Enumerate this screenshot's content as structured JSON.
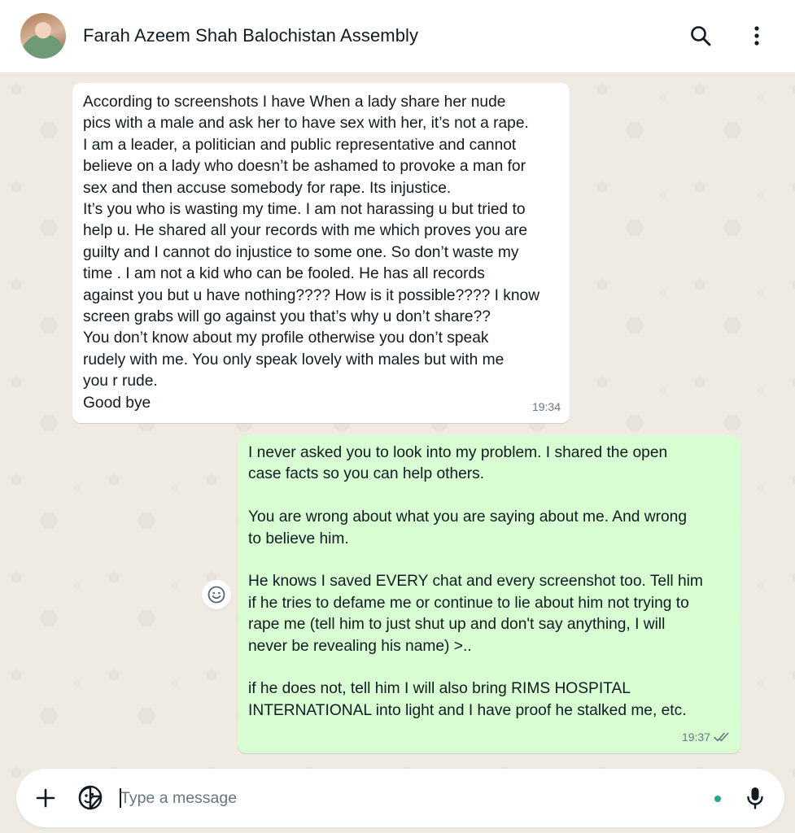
{
  "header": {
    "contact_name": "Farah Azeem Shah Balochistan Assembly",
    "icons": [
      "search-icon",
      "more-menu-icon"
    ]
  },
  "messages": [
    {
      "direction": "incoming",
      "time": "19:34",
      "lines": [
        "According to screenshots I have When a lady share her nude",
        "pics with a male and ask her to have sex with her, it’s not a rape.",
        "I am a leader, a politician and public representative and cannot",
        "believe on a lady who doesn’t be ashamed to provoke a man for",
        "sex and then accuse somebody for rape. Its injustice.",
        "It’s you who is wasting my time. I am not harassing u but tried to",
        "help u. He shared all your records with me which proves you are",
        "guilty and I cannot do injustice to some one. So don’t waste my",
        "time . I am not a kid who can be fooled. He has all records",
        "against you but u have nothing???? How is it possible???? I know",
        "screen grabs will go against you that’s why u don’t share??",
        "You don’t know about my profile otherwise you don’t speak",
        "rudely with me. You only speak lovely with males but with me",
        "you r rude.",
        "Good bye"
      ]
    },
    {
      "direction": "outgoing",
      "time": "19:37",
      "status": "read",
      "lines": [
        "I never asked you to look into my problem. I shared the open",
        "case facts so you can help others.",
        "",
        "You are wrong about what you are saying about me. And wrong",
        "to believe him.",
        "",
        "He knows I saved EVERY chat and every screenshot too. Tell him",
        "if he tries to defame me or continue to lie about him not trying to",
        "rape me (tell him to just shut up and don't say anything, I will",
        "never be revealing his name) >..",
        "",
        "if he does not, tell him I will also bring RIMS HOSPITAL",
        "INTERNATIONAL into light and I have proof he stalked me, etc."
      ]
    }
  ],
  "composer": {
    "placeholder": "Type a message",
    "value": ""
  },
  "colors": {
    "incoming_bubble": "#ffffff",
    "outgoing_bubble": "#d9fdd3",
    "chat_background": "#efeae2",
    "meta_text": "#667781",
    "accent": "#25a889"
  }
}
